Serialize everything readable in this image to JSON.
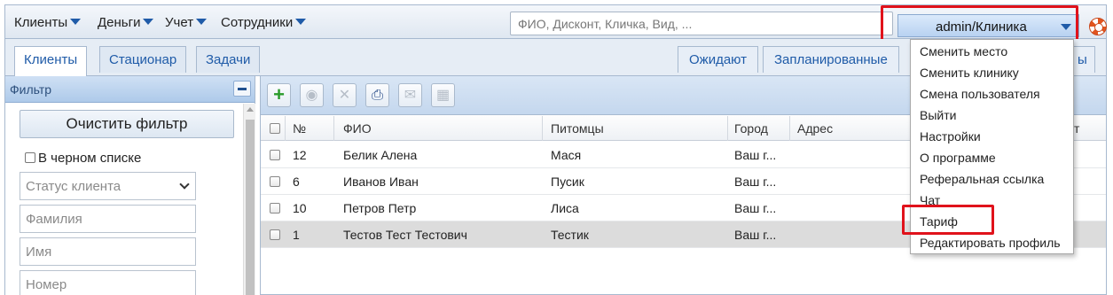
{
  "menu": {
    "items": [
      "Клиенты",
      "Деньги",
      "Учет",
      "Сотрудники"
    ]
  },
  "search": {
    "placeholder": "ФИО, Дисконт, Кличка, Вид, ..."
  },
  "user": {
    "label": "admin/Клиника"
  },
  "tabs": [
    "Клиенты",
    "Стационар",
    "Задачи"
  ],
  "right_tabs": [
    "Ожидают",
    "Запланированные",
    "ы"
  ],
  "filter": {
    "title": "Фильтр",
    "clear_label": "Очистить фильтр",
    "blacklist_label": "В черном списке",
    "status_placeholder": "Статус клиента",
    "lastname_placeholder": "Фамилия",
    "name_placeholder": "Имя",
    "number_placeholder": "Номер"
  },
  "table": {
    "headers": [
      "№",
      "ФИО",
      "Питомцы",
      "Город",
      "Адрес",
      "т"
    ],
    "rows": [
      {
        "num": "12",
        "name": "Белик Алена",
        "pets": "Мася",
        "city": "Ваш г..."
      },
      {
        "num": "6",
        "name": "Иванов Иван",
        "pets": "Пусик",
        "city": "Ваш г..."
      },
      {
        "num": "10",
        "name": "Петров Петр",
        "pets": "Лиса",
        "city": "Ваш г..."
      },
      {
        "num": "1",
        "name": "Тестов Тест Тестович",
        "pets": "Тестик",
        "city": "Ваш г..."
      }
    ],
    "selected_row": 3
  },
  "user_menu": {
    "items": [
      "Сменить место",
      "Сменить клинику",
      "Смена пользователя",
      "Выйти",
      "Настройки",
      "О программе",
      "Реферальная ссылка",
      "Чат",
      "Тариф",
      "Редактировать профиль"
    ],
    "highlighted": "Тариф"
  },
  "colors": {
    "highlight": "#e0121b",
    "accent": "#1f5ba8",
    "add": "#2a9b2a"
  }
}
